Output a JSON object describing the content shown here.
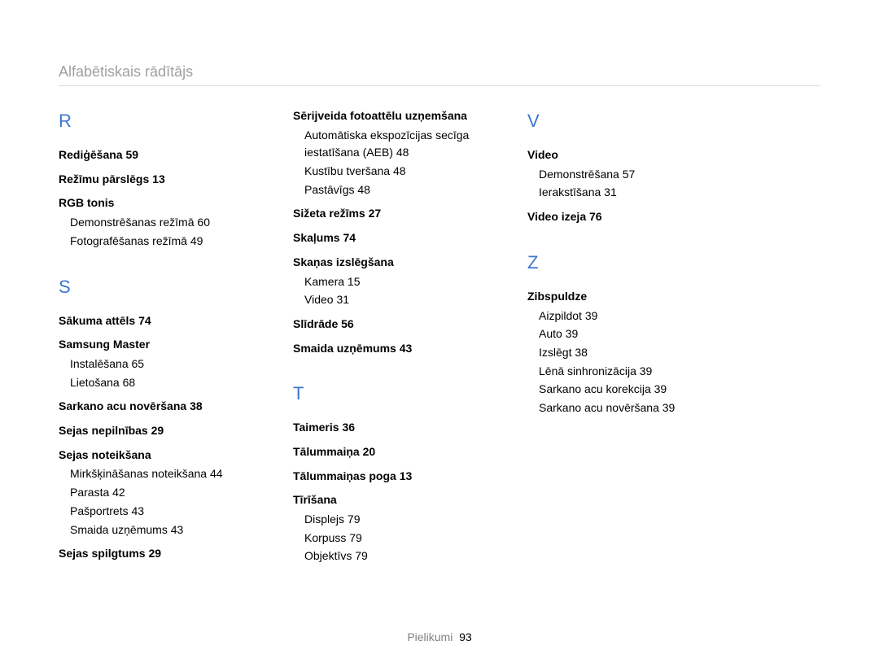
{
  "header": {
    "title": "Alfabētiskais rādītājs"
  },
  "footer": {
    "label": "Pielikumi",
    "page": "93"
  },
  "columns": [
    [
      {
        "letter": "R",
        "entries": [
          {
            "label": "Rediģēšana",
            "page": "59"
          },
          {
            "label": "Režīmu pārslēgs",
            "page": "13"
          },
          {
            "label": "RGB tonis",
            "subs": [
              {
                "label": "Demonstrēšanas režīmā",
                "page": "60"
              },
              {
                "label": "Fotografēšanas režīmā",
                "page": "49"
              }
            ]
          }
        ]
      },
      {
        "letter": "S",
        "entries": [
          {
            "label": "Sākuma attēls",
            "page": "74"
          },
          {
            "label": "Samsung Master",
            "subs": [
              {
                "label": "Instalēšana",
                "page": "65"
              },
              {
                "label": "Lietošana",
                "page": "68"
              }
            ]
          },
          {
            "label": "Sarkano acu novēršana",
            "page": "38"
          },
          {
            "label": "Sejas nepilnības",
            "page": "29"
          },
          {
            "label": "Sejas noteikšana",
            "subs": [
              {
                "label": "Mirkšķināšanas noteikšana",
                "page": "44"
              },
              {
                "label": "Parasta",
                "page": "42"
              },
              {
                "label": "Pašportrets",
                "page": "43"
              },
              {
                "label": "Smaida uzņēmums",
                "page": "43"
              }
            ]
          },
          {
            "label": "Sejas spilgtums",
            "page": "29"
          }
        ]
      }
    ],
    [
      {
        "letter": "",
        "entries": [
          {
            "label": "Sērijveida fotoattēlu uzņemšana",
            "subs": [
              {
                "label": "Automātiska ekspozīcijas secīga iestatīšana (AEB)",
                "page": "48"
              },
              {
                "label": "Kustību tveršana",
                "page": "48"
              },
              {
                "label": "Pastāvīgs",
                "page": "48"
              }
            ]
          },
          {
            "label": "Sižeta režīms",
            "page": "27"
          },
          {
            "label": "Skaļums",
            "page": "74"
          },
          {
            "label": "Skaņas izslēgšana",
            "subs": [
              {
                "label": "Kamera",
                "page": "15"
              },
              {
                "label": "Video",
                "page": "31"
              }
            ]
          },
          {
            "label": "Slīdrāde",
            "page": "56"
          },
          {
            "label": "Smaida uzņēmums",
            "page": "43"
          }
        ]
      },
      {
        "letter": "T",
        "entries": [
          {
            "label": "Taimeris",
            "page": "36"
          },
          {
            "label": "Tālummaiņa",
            "page": "20"
          },
          {
            "label": "Tālummaiņas poga",
            "page": "13"
          },
          {
            "label": "Tīrīšana",
            "subs": [
              {
                "label": "Displejs",
                "page": "79"
              },
              {
                "label": "Korpuss",
                "page": "79"
              },
              {
                "label": "Objektīvs",
                "page": "79"
              }
            ]
          }
        ]
      }
    ],
    [
      {
        "letter": "V",
        "entries": [
          {
            "label": "Video",
            "subs": [
              {
                "label": "Demonstrēšana",
                "page": "57"
              },
              {
                "label": "Ierakstīšana",
                "page": "31"
              }
            ]
          },
          {
            "label": "Video izeja",
            "page": "76"
          }
        ]
      },
      {
        "letter": "Z",
        "entries": [
          {
            "label": "Zibspuldze",
            "subs": [
              {
                "label": "Aizpildot",
                "page": "39"
              },
              {
                "label": "Auto",
                "page": "39"
              },
              {
                "label": "Izslēgt",
                "page": "38"
              },
              {
                "label": "Lēnā sinhronizācija",
                "page": "39"
              },
              {
                "label": "Sarkano acu korekcija",
                "page": "39"
              },
              {
                "label": "Sarkano acu novēršana",
                "page": "39"
              }
            ]
          }
        ]
      }
    ]
  ]
}
